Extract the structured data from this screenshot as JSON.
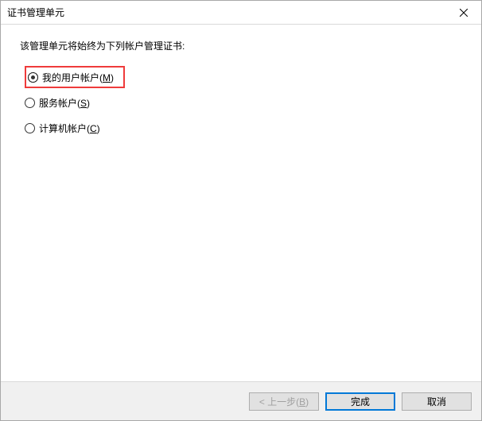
{
  "window": {
    "title": "证书管理单元"
  },
  "content": {
    "prompt": "该管理单元将始终为下列帐户管理证书:",
    "options": {
      "user": {
        "label_pre": "我的用户帐户(",
        "hotkey": "M",
        "label_post": ")",
        "checked": true
      },
      "service": {
        "label_pre": "服务帐户(",
        "hotkey": "S",
        "label_post": ")",
        "checked": false
      },
      "computer": {
        "label_pre": "计算机帐户(",
        "hotkey": "C",
        "label_post": ")",
        "checked": false
      }
    }
  },
  "buttons": {
    "back": {
      "label_pre": "< 上一步(",
      "hotkey": "B",
      "label_post": ")",
      "disabled": true
    },
    "finish": {
      "label": "完成",
      "primary": true
    },
    "cancel": {
      "label": "取消"
    }
  }
}
